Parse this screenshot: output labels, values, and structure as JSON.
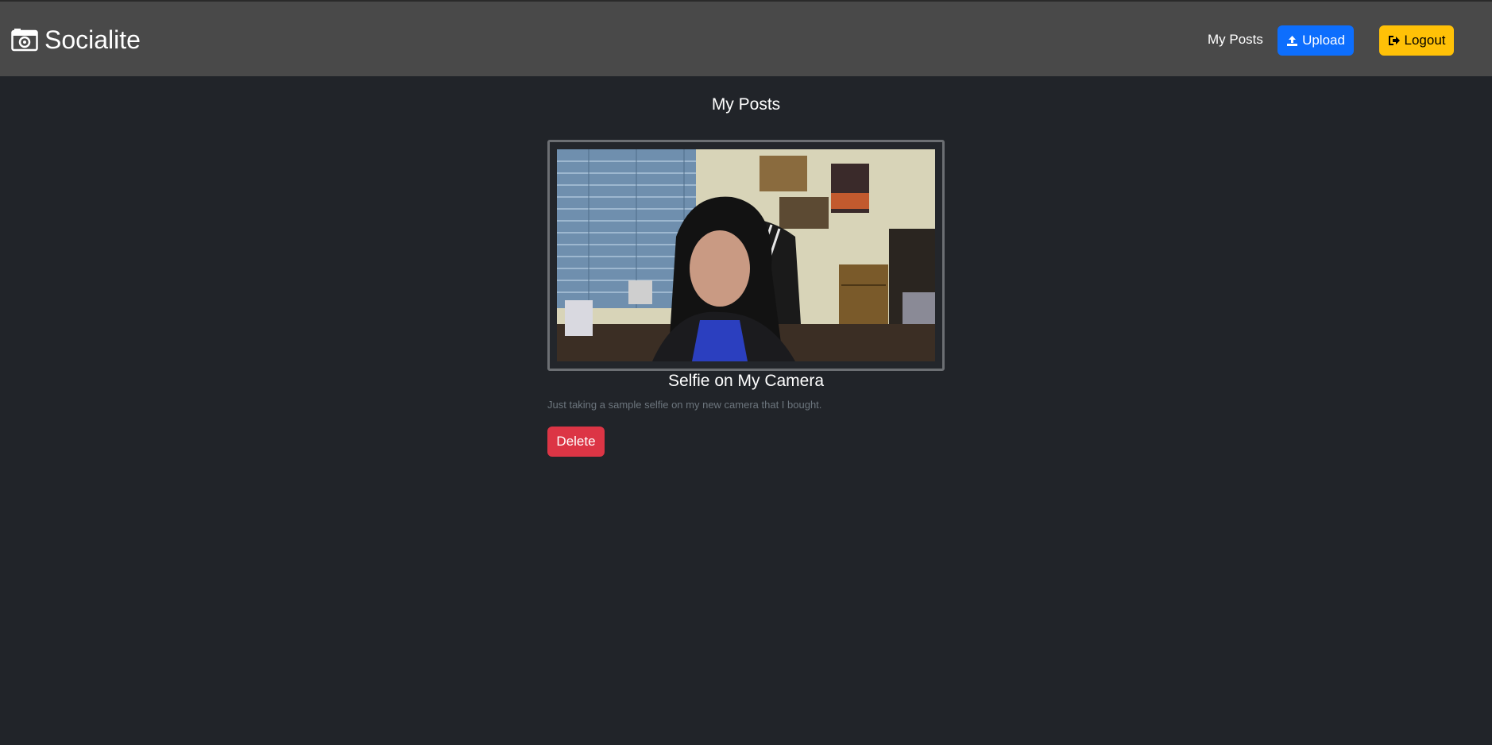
{
  "brand": {
    "name": "Socialite",
    "icon": "camera-icon"
  },
  "nav": {
    "my_posts_label": "My Posts",
    "upload_label": "Upload",
    "upload_icon": "upload-icon",
    "logout_label": "Logout",
    "logout_icon": "logout-icon"
  },
  "page": {
    "title": "My Posts"
  },
  "posts": [
    {
      "title": "Selfie on My Camera",
      "description": "Just taking a sample selfie on my new camera that I bought.",
      "delete_label": "Delete"
    }
  ],
  "colors": {
    "navbar": "#494949",
    "background": "#212429",
    "upload": "#0d6efd",
    "logout": "#ffc107",
    "delete": "#dc3545"
  }
}
